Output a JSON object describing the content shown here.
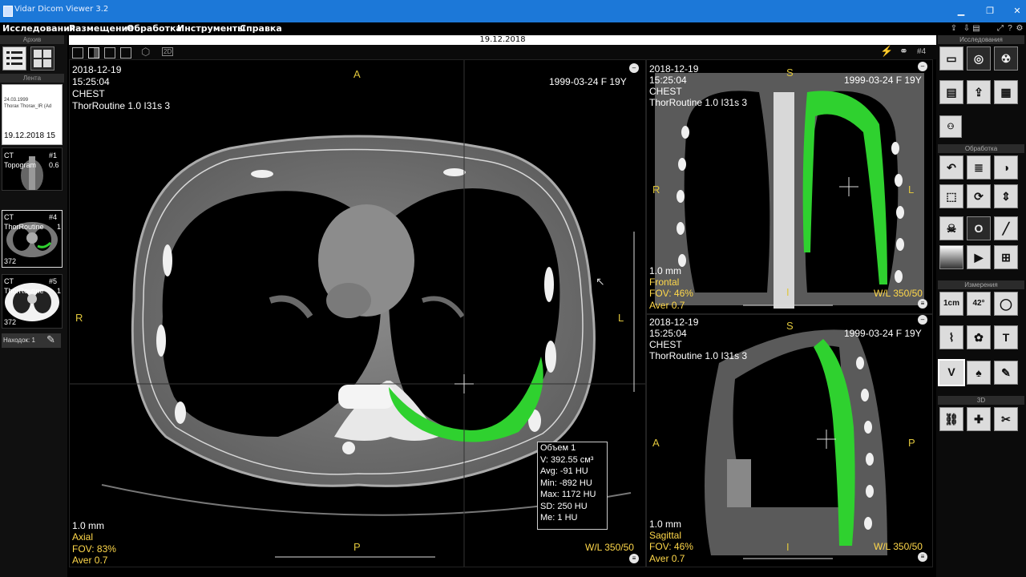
{
  "window": {
    "title": "Vidar Dicom Viewer 3.2"
  },
  "menu": [
    "Исследования",
    "Размещение",
    "Обработка",
    "Инструменты",
    "Справка"
  ],
  "datebar": {
    "date": "19.12.2018"
  },
  "left_panel": {
    "archive_header": "Архив",
    "feed_header": "Лента",
    "study_card": {
      "line1": "24.03.1999",
      "line2": "Thorax Thorax_IR (Ad",
      "date": "19.12.2018 15"
    },
    "series": [
      {
        "modality": "CT",
        "num": "#1",
        "name": "Topogram",
        "param": "0.6",
        "count": ""
      },
      {
        "modality": "CT",
        "num": "#4",
        "name": "ThorRoutine",
        "param": "1",
        "count": "372"
      },
      {
        "modality": "CT",
        "num": "#5",
        "name": "ThorRoutine",
        "param": "1",
        "count": "372"
      }
    ],
    "findings": "Находок: 1"
  },
  "axial": {
    "date": "2018-12-19",
    "time": "15:25:04",
    "body": "CHEST",
    "series": "ThorRoutine  1.0  I31s  3",
    "patient": "1999-03-24 F   19Y",
    "orient": {
      "top": "A",
      "left": "R",
      "right": "L",
      "bottom": "P"
    },
    "thickness": "1.0 mm",
    "plane": "Axial",
    "fov": "FOV: 83%",
    "aver": "Aver 0.7",
    "wl": "W/L 350/50",
    "series_num": "#4"
  },
  "frontal": {
    "date": "2018-12-19",
    "time": "15:25:04",
    "body": "CHEST",
    "series": "ThorRoutine  1.0  I31s  3",
    "patient": "1999-03-24 F   19Y",
    "orient": {
      "top": "S",
      "left": "R",
      "right": "L",
      "bottom": "I"
    },
    "thickness": "1.0 mm",
    "plane": "Frontal",
    "fov": "FOV: 46%",
    "aver": "Aver 0.7",
    "wl": "W/L 350/50"
  },
  "sagittal": {
    "date": "2018-12-19",
    "time": "15:25:04",
    "body": "CHEST",
    "series": "ThorRoutine  1.0  I31s  3",
    "patient": "1999-03-24 F   19Y",
    "orient": {
      "top": "S",
      "left": "A",
      "right": "P",
      "bottom": "I"
    },
    "thickness": "1.0 mm",
    "plane": "Sagittal",
    "fov": "FOV: 46%",
    "aver": "Aver 0.7",
    "wl": "W/L 350/50"
  },
  "measurement": {
    "title": "Объем 1",
    "volume": "V: 392.55 см³",
    "avg": "Avg: -91 HU",
    "min": "Min: -892 HU",
    "max": "Max: 1172 HU",
    "sd": "SD: 250 HU",
    "me": "Me: 1 HU"
  },
  "right_panel": {
    "studies_header": "Исследования",
    "processing_header": "Обработка",
    "measure_header": "Измерения",
    "threed_header": "3D",
    "tool_1cm": "1cm",
    "tool_angle": "42°"
  },
  "colors": {
    "titlebar": "#1c78d8",
    "segmentation": "#2fd12f",
    "overlay_orient": "#e0c63c"
  }
}
